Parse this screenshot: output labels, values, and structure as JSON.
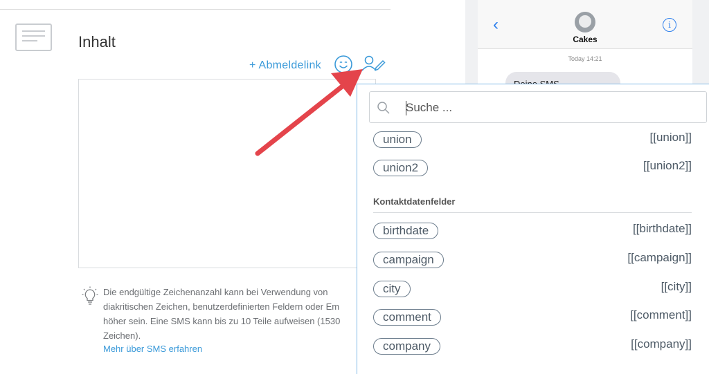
{
  "editor": {
    "title": "Inhalt",
    "unsubscribe_link": "+ Abmeldelink",
    "hint_lines": [
      "Die endgültige Zeichenanzahl kann bei Verwendung von",
      "diakritischen Zeichen, benutzerdefinierten Feldern oder Em",
      "höher sein. Eine SMS kann bis zu 10 Teile aufweisen (1530",
      "Zeichen)."
    ],
    "more_link": "Mehr über SMS erfahren"
  },
  "phone": {
    "contact_name": "Cakes",
    "timestamp": "Today 14:21",
    "bubble_text": "Deine SMS"
  },
  "dropdown": {
    "search_placeholder": "Suche ...",
    "items_top": [
      {
        "label": "union",
        "code": "[[union]]"
      },
      {
        "label": "union2",
        "code": "[[union2]]"
      }
    ],
    "group_label": "Kontaktdatenfelder",
    "contact_fields": [
      {
        "label": "birthdate",
        "code": "[[birthdate]]"
      },
      {
        "label": "campaign",
        "code": "[[campaign]]"
      },
      {
        "label": "city",
        "code": "[[city]]"
      },
      {
        "label": "comment",
        "code": "[[comment]]"
      },
      {
        "label": "company",
        "code": "[[company]]"
      }
    ]
  },
  "colors": {
    "accent": "#3b9ad9",
    "arrow": "#e4444b",
    "ios_blue": "#2f80ed"
  }
}
